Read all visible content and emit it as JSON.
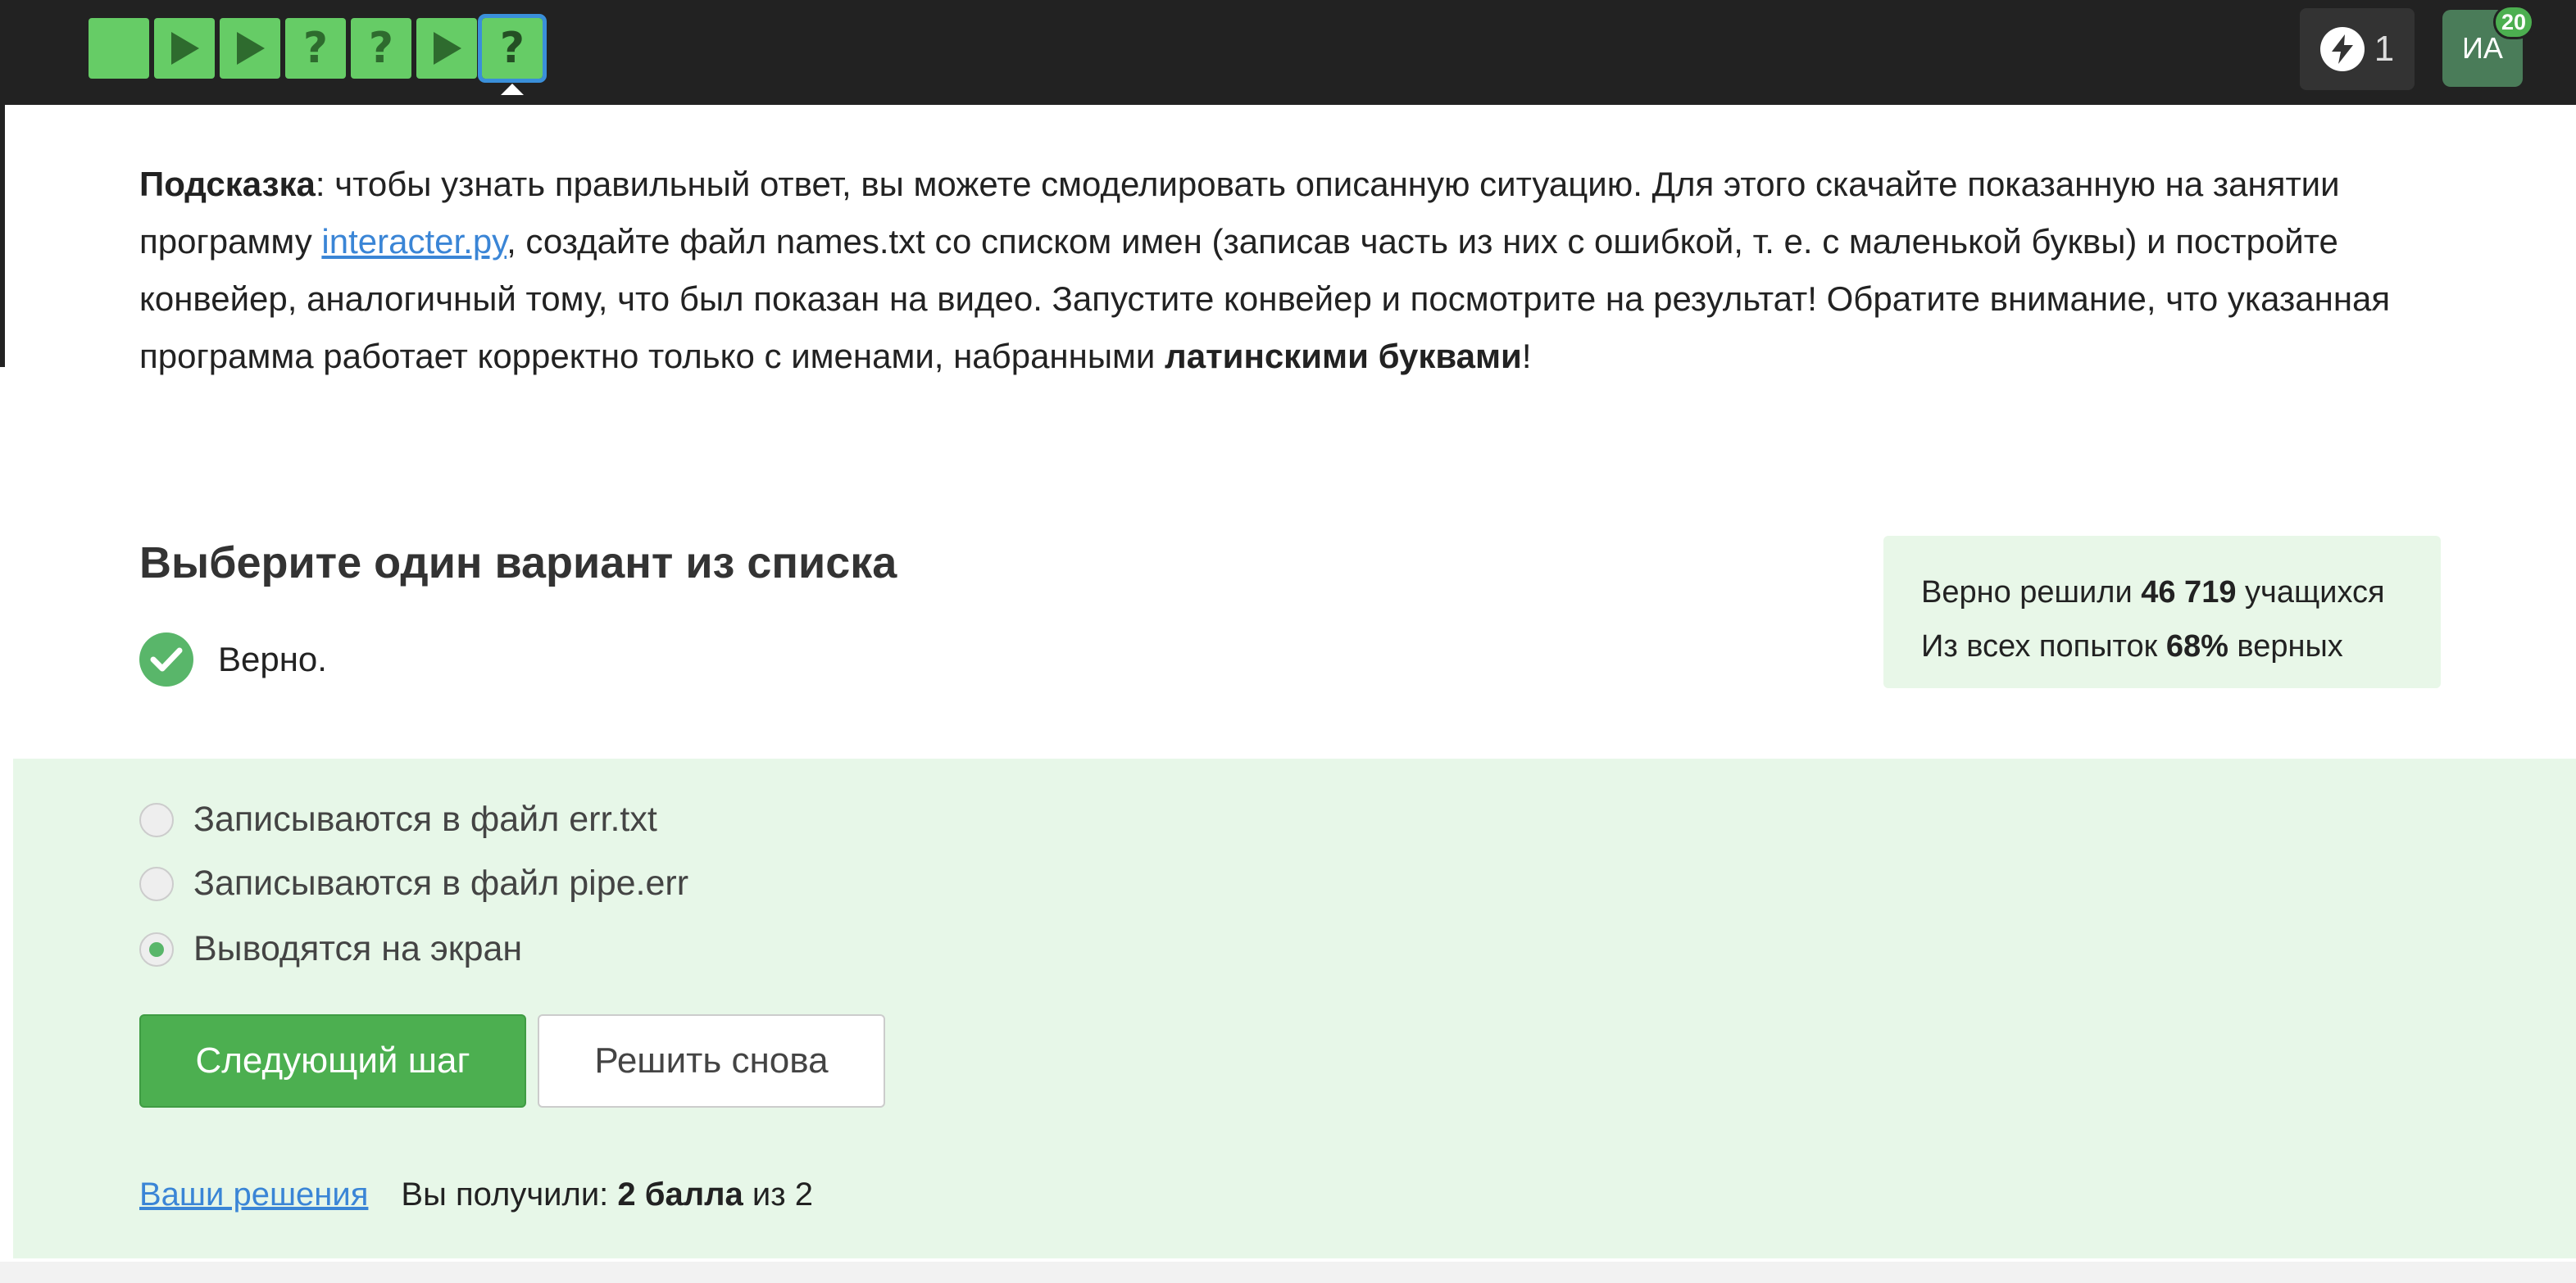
{
  "topbar": {
    "steps": [
      {
        "kind": "blank",
        "icon": "",
        "current": false
      },
      {
        "kind": "video",
        "icon": "play-icon",
        "current": false
      },
      {
        "kind": "video",
        "icon": "play-icon",
        "current": false
      },
      {
        "kind": "quiz",
        "icon": "question-icon",
        "label": "?",
        "current": false
      },
      {
        "kind": "quiz",
        "icon": "question-icon",
        "label": "?",
        "current": false
      },
      {
        "kind": "video",
        "icon": "play-icon",
        "current": false
      },
      {
        "kind": "quiz",
        "icon": "question-icon",
        "label": "?",
        "current": true
      }
    ],
    "energy_count": "1",
    "avatar_initials": "ИА",
    "avatar_badge": "20"
  },
  "hint": {
    "label": "Подсказка",
    "text_1": ": чтобы узнать правильный ответ, вы можете смоделировать описанную ситуацию. Для этого скачайте показанную на занятии программу ",
    "link": "interacter.py",
    "text_2": ", создайте файл names.txt со списком имен (записав часть из них с ошибкой, т. е. с маленькой буквы) и постройте конвейер, аналогичный тому, что был показан на видео. Запустите конвейер и посмотрите на результат! Обратите внимание, что указанная программа работает корректно только с именами, набранными ",
    "bold_end": "латинскими буквами",
    "text_3": "!"
  },
  "question": {
    "title": "Выберите один вариант из списка",
    "result": "Верно."
  },
  "stats": {
    "line1_prefix": "Верно решили ",
    "line1_value": "46 719",
    "line1_suffix": " учащихся",
    "line2_prefix": "Из всех попыток ",
    "line2_value": "68%",
    "line2_suffix": " верных"
  },
  "options": [
    {
      "label": "Записываются в файл err.txt",
      "checked": false
    },
    {
      "label": "Записываются в файл pipe.err",
      "checked": false
    },
    {
      "label": "Выводятся на экран",
      "checked": true
    }
  ],
  "buttons": {
    "next": "Следующий шаг",
    "retry": "Решить снова"
  },
  "footer": {
    "solutions_link": "Ваши решения",
    "score_prefix": "Вы получили: ",
    "score_value": "2 балла",
    "score_suffix": " из 2"
  },
  "colors": {
    "topbar_bg": "#222222",
    "step_green": "#66cc66",
    "accent_green": "#4caf50",
    "panel_green": "#e7f7e8",
    "link_blue": "#3a85d6"
  }
}
